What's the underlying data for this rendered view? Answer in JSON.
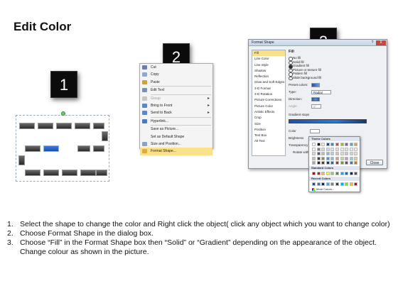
{
  "title": "Edit Color",
  "badges": [
    "1",
    "2",
    "3"
  ],
  "context_menu": {
    "items": [
      {
        "label": "Cut",
        "accel": "t",
        "icon": "scissors-icon"
      },
      {
        "label": "Copy",
        "icon": "copy-icon"
      },
      {
        "label": "Paste",
        "icon": "paste-icon"
      },
      {
        "label": "Edit Text",
        "icon": "edit-text-icon"
      },
      {
        "label": "Group",
        "icon": "group-icon",
        "disabled": true,
        "submenu": true
      },
      {
        "label": "Bring to Front",
        "icon": "bring-front-icon",
        "submenu": true
      },
      {
        "label": "Send to Back",
        "icon": "send-back-icon",
        "submenu": true
      },
      {
        "label": "Hyperlink...",
        "icon": "hyperlink-icon"
      },
      {
        "label": "Save as Picture...",
        "icon": ""
      },
      {
        "label": "Set as Default Shape",
        "icon": ""
      },
      {
        "label": "Size and Position...",
        "icon": "size-icon"
      },
      {
        "label": "Format Shape...",
        "icon": "format-shape-icon",
        "highlighted": true
      }
    ]
  },
  "dialog": {
    "title": "Format Shape",
    "close": "X",
    "help": "?",
    "categories": [
      "Fill",
      "Line Color",
      "Line Style",
      "Shadow",
      "Reflection",
      "Glow and Soft Edges",
      "3-D Format",
      "3-D Rotation",
      "Picture Corrections",
      "Picture Color",
      "Artistic Effects",
      "Crop",
      "Size",
      "Position",
      "Text Box",
      "Alt Text"
    ],
    "selected_category": "Fill",
    "panel_title": "Fill",
    "fill_options": [
      "No fill",
      "Solid fill",
      "Gradient fill",
      "Picture or texture fill",
      "Pattern fill",
      "Slide background fill"
    ],
    "selected_fill": "Gradient fill",
    "preset_label": "Preset colors:",
    "type_label": "Type:",
    "type_value": "Radial",
    "direction_label": "Direction:",
    "angle_label": "Angle:",
    "angle_value": "0°",
    "stops_label": "Gradient stops",
    "color_label": "Color",
    "brightness_label": "Brightness",
    "transparency_label": "Transparency",
    "rotate_label": "Rotate with shape",
    "close_button": "Close"
  },
  "palette": {
    "theme_label": "Theme Colors",
    "standard_label": "Standard Colors",
    "recent_label": "Recent Colors",
    "more_label": "More Colors...",
    "theme_colors": [
      "#ffffff",
      "#000000",
      "#eeece1",
      "#1f497d",
      "#4f81bd",
      "#c0504d",
      "#9bbb59",
      "#8064a2",
      "#4bacc6",
      "#f79646",
      "#f2f2f2",
      "#7f7f7f",
      "#ddd9c3",
      "#c6d9f0",
      "#dbe5f1",
      "#f2dcdb",
      "#ebf1dd",
      "#e5e0ec",
      "#dbeef3",
      "#fdeada",
      "#d8d8d8",
      "#595959",
      "#c4bd97",
      "#8db3e2",
      "#b8cce4",
      "#e5b9b7",
      "#d7e3bc",
      "#ccc1d9",
      "#b7dde8",
      "#fbd5b5",
      "#bfbfbf",
      "#3f3f3f",
      "#938953",
      "#548dd4",
      "#95b3d7",
      "#d99694",
      "#c3d69b",
      "#b2a2c7",
      "#92cddc",
      "#fac08f",
      "#a5a5a5",
      "#262626",
      "#494429",
      "#17365d",
      "#366092",
      "#953734",
      "#76923c",
      "#5f497a",
      "#31859b",
      "#e36c09"
    ],
    "standard_colors": [
      "#c00000",
      "#ff0000",
      "#ffc000",
      "#ffff00",
      "#92d050",
      "#00b050",
      "#00b0f0",
      "#0070c0",
      "#002060",
      "#7030a0"
    ],
    "recent_colors": [
      "#1f4e8c",
      "#2e75b6",
      "#0a2a5e",
      "#5b9bd5",
      "#7f7f7f",
      "#3a3a3a",
      "#00b0f0",
      "#92d050",
      "#ffc000",
      "#c00000"
    ]
  },
  "instructions": [
    {
      "num": "1.",
      "text": "Select the shape to change the color and Right click the object( click any object which you want to change color)"
    },
    {
      "num": "2.",
      "text": "Choose Format Shape in the dialog box."
    },
    {
      "num": "3.",
      "text": "Choose “Fill” in the Format Shape box then “Solid” or “Gradient” depending on the appearance of the object. Change colour as shown in the picture."
    }
  ]
}
